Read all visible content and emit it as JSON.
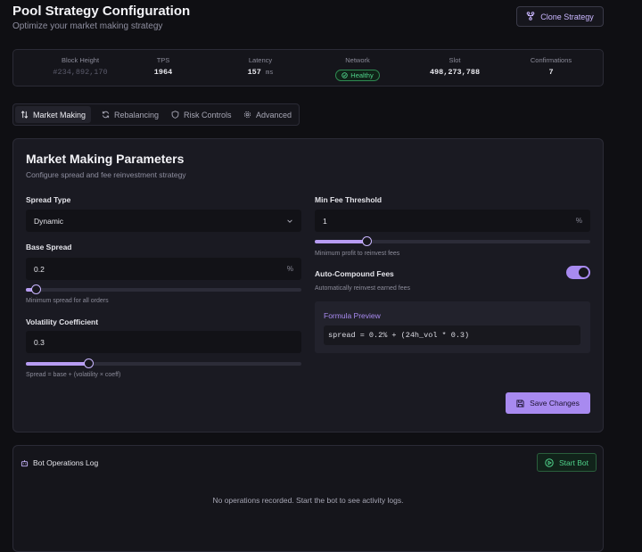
{
  "header": {
    "title": "Pool Strategy Configuration",
    "subtitle": "Optimize your market making strategy",
    "clone_label": "Clone Strategy"
  },
  "stats": [
    {
      "label": "Block Height",
      "value": "#234,892,170"
    },
    {
      "label": "TPS",
      "value": "1964"
    },
    {
      "label": "Latency",
      "value": "157",
      "unit": "ms"
    },
    {
      "label": "Network",
      "value": "Healthy"
    },
    {
      "label": "Slot",
      "value": "498,273,788"
    },
    {
      "label": "Confirmations",
      "value": "7"
    }
  ],
  "tabs": [
    {
      "label": "Market Making",
      "icon": "arrows-up-down-icon",
      "active": true
    },
    {
      "label": "Rebalancing",
      "icon": "refresh-icon"
    },
    {
      "label": "Risk Controls",
      "icon": "shield-icon"
    },
    {
      "label": "Advanced",
      "icon": "gear-icon"
    }
  ],
  "params": {
    "title": "Market Making Parameters",
    "subtitle": "Configure spread and fee reinvestment strategy",
    "spread_type": {
      "label": "Spread Type",
      "value": "Dynamic"
    },
    "base_spread": {
      "label": "Base Spread",
      "value": "0.2",
      "suffix": "%",
      "helper": "Minimum spread for all orders",
      "slider_fraction": 0.04
    },
    "volatility": {
      "label": "Volatility Coefficient",
      "value": "0.3",
      "helper": "Spread = base + (volatility × coeff)",
      "slider_fraction": 0.23
    },
    "min_fee": {
      "label": "Min Fee Threshold",
      "value": "1",
      "suffix": "%",
      "helper": "Minimum profit to reinvest fees",
      "slider_fraction": 0.19
    },
    "auto_compound": {
      "label": "Auto-Compound Fees",
      "helper": "Automatically reinvest earned fees",
      "enabled": true
    },
    "formula": {
      "title": "Formula Preview",
      "code": "spread = 0.2% + (24h_vol * 0.3)"
    },
    "save_label": "Save Changes"
  },
  "log": {
    "title": "Bot Operations Log",
    "start_label": "Start Bot",
    "empty_text": "No operations recorded. Start the bot to see activity logs."
  },
  "colors": {
    "accent": "#a88af0",
    "success": "#4fd18a",
    "background": "#0f0f13"
  }
}
